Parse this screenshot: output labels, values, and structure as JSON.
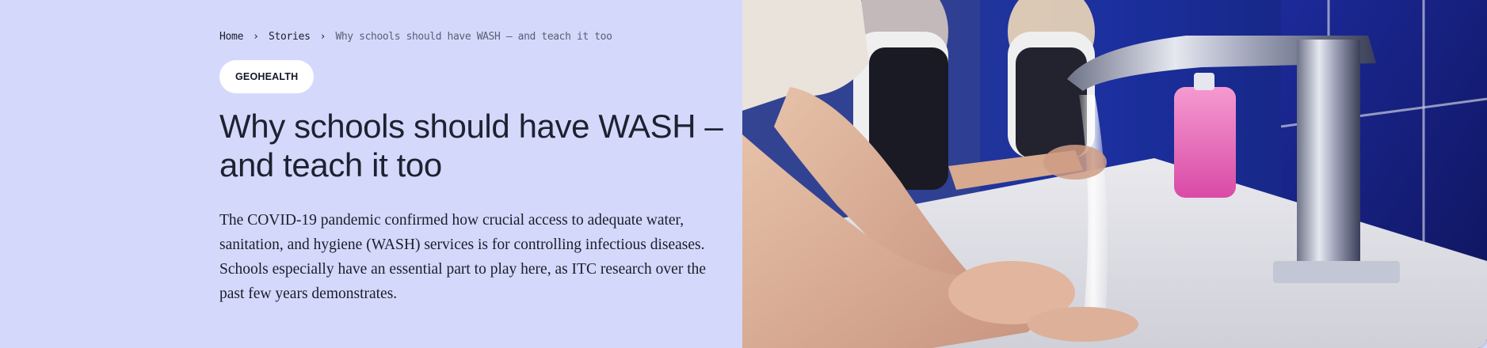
{
  "breadcrumb": {
    "home": "Home",
    "stories": "Stories",
    "current": "Why schools should have WASH – and teach it too"
  },
  "tag": "GEOHEALTH",
  "title": "Why schools should have WASH – and teach it too",
  "intro": "The COVID-19 pandemic confirmed how crucial access to adequate water, sanitation, and hygiene (WASH) services is for controlling infectious diseases. Schools especially have an essential part to play here, as ITC research over the past few years demonstrates.",
  "colors": {
    "panel_bg": "#d4d9fc",
    "text": "#1e2130",
    "tag_bg": "#ffffff"
  },
  "icons": {
    "breadcrumb_separator": "chevron-right-icon"
  }
}
